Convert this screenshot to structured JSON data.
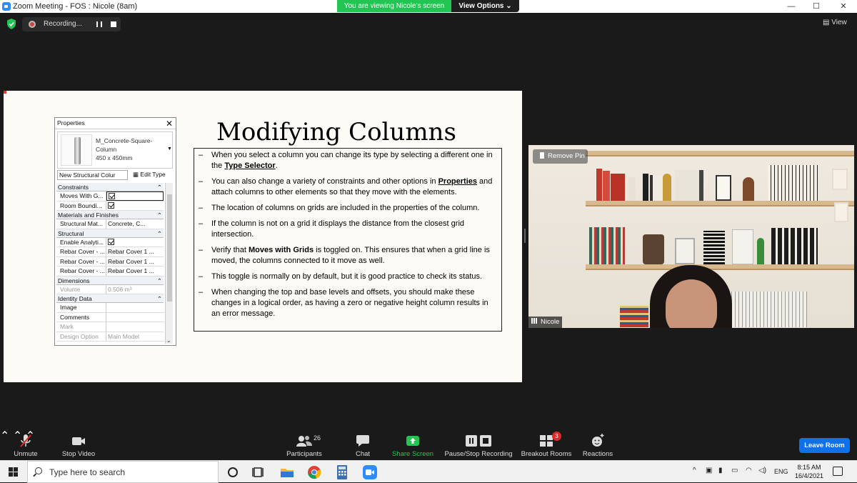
{
  "window": {
    "title": "Zoom Meeting - FOS : Nicole (8am)",
    "share_banner": "You are viewing Nicole's screen",
    "view_options": "View Options",
    "controls": {
      "minimize": "—",
      "maximize": "☐",
      "close": "✕"
    }
  },
  "top_strip": {
    "recording_label": "Recording...",
    "view_button": "View"
  },
  "slide": {
    "title": "Modifying Columns",
    "properties_panel": {
      "header": "Properties",
      "close": "✕",
      "type_name_line1": "M_Concrete-Square-",
      "type_name_line2": "Column",
      "type_name_line3": "450 x 450mm",
      "instance_selector": "New Structural Colur",
      "edit_type": "Edit Type",
      "sections": [
        {
          "name": "Constraints",
          "rows": [
            {
              "key": "Moves With G...",
              "value": ""
            },
            {
              "key": "Room Boundi...",
              "value": ""
            }
          ]
        },
        {
          "name": "Materials and Finishes",
          "rows": [
            {
              "key": "Structural Mat...",
              "value": "Concrete, C..."
            }
          ]
        },
        {
          "name": "Structural",
          "rows": [
            {
              "key": "Enable Analyti...",
              "value": ""
            },
            {
              "key": "Rebar Cover - ...",
              "value": "Rebar Cover 1 ..."
            },
            {
              "key": "Rebar Cover - ...",
              "value": "Rebar Cover 1 ..."
            },
            {
              "key": "Rebar Cover - ...",
              "value": "Rebar Cover 1 ..."
            }
          ]
        },
        {
          "name": "Dimensions",
          "rows": [
            {
              "key": "Volume",
              "value": "0.506 m³"
            }
          ]
        },
        {
          "name": "Identity Data",
          "rows": [
            {
              "key": "Image",
              "value": ""
            },
            {
              "key": "Comments",
              "value": ""
            },
            {
              "key": "Mark",
              "value": ""
            },
            {
              "key": "Design Option",
              "value": "Main Model"
            }
          ]
        }
      ]
    },
    "bullets": [
      {
        "pre": "When you select a column you can change its type by selecting a different one in the ",
        "bold": "Type Selector",
        "post": "."
      },
      {
        "pre": "You can also change a variety of constraints and other options in ",
        "bold": "Properties",
        "post": " and attach columns to other elements so that they move with the elements."
      },
      {
        "pre": "The location of columns on grids are included in the properties of the column.",
        "bold": "",
        "post": ""
      },
      {
        "pre": "If the column is not on a grid it displays the distance from the closest grid intersection.",
        "bold": "",
        "post": ""
      },
      {
        "pre": "Verify that ",
        "bold": "Moves with Grids",
        "post": " is toggled on. This ensures that when a grid line is moved, the columns connected to it move as well."
      },
      {
        "pre": "This toggle is normally on by default, but it is good practice to check its status.",
        "bold": "",
        "post": ""
      },
      {
        "pre": "When changing the top and base levels and offsets, you should make these changes in a logical order, as having a zero or negative height column results in an error message.",
        "bold": "",
        "post": ""
      }
    ]
  },
  "video": {
    "remove_pin": "Remove Pin",
    "participant_name": "Nicole"
  },
  "toolbar": {
    "unmute": "Unmute",
    "stop_video": "Stop Video",
    "participants": "Participants",
    "participants_count": "26",
    "chat": "Chat",
    "share_screen": "Share Screen",
    "pause_stop_recording": "Pause/Stop Recording",
    "breakout_rooms": "Breakout Rooms",
    "breakout_badge": "3",
    "reactions": "Reactions",
    "leave_room": "Leave Room"
  },
  "taskbar": {
    "search_placeholder": "Type here to search",
    "language": "ENG",
    "time": "8:15 AM",
    "date": "16/4/2021"
  },
  "colors": {
    "share_green": "#23c552",
    "leave_blue": "#0e71eb",
    "meeting_bg": "#1a1a1a"
  }
}
